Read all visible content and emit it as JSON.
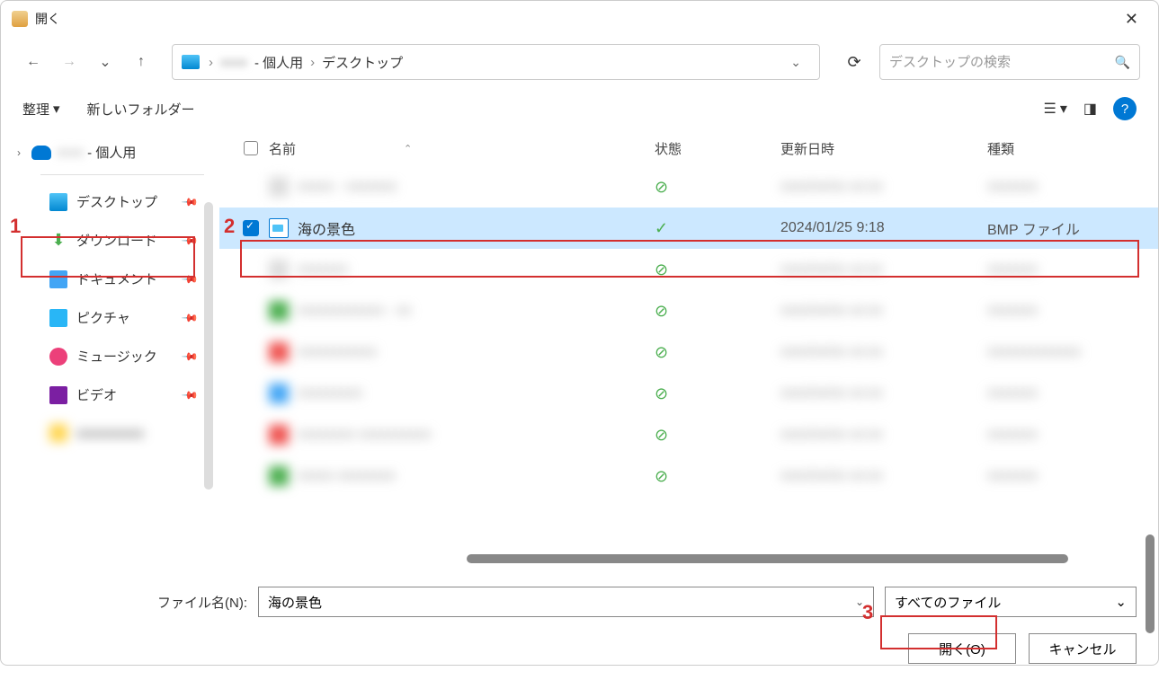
{
  "titlebar": {
    "title": "開く"
  },
  "nav": {
    "path_personal_suffix": "- 個人用",
    "path_desktop": "デスクトップ",
    "search_placeholder": "デスクトップの検索"
  },
  "toolbar": {
    "organize": "整理",
    "new_folder": "新しいフォルダー"
  },
  "sidebar": {
    "personal_suffix": "- 個人用",
    "items": [
      {
        "label": "デスクトップ",
        "icon": "desktop"
      },
      {
        "label": "ダウンロード",
        "icon": "download"
      },
      {
        "label": "ドキュメント",
        "icon": "document"
      },
      {
        "label": "ピクチャ",
        "icon": "pictures"
      },
      {
        "label": "ミュージック",
        "icon": "music"
      },
      {
        "label": "ビデオ",
        "icon": "video"
      }
    ]
  },
  "columns": {
    "name": "名前",
    "state": "状態",
    "modified": "更新日時",
    "type": "種類"
  },
  "selected_file": {
    "name": "海の景色",
    "modified": "2024/01/25 9:18",
    "type": "BMP ファイル"
  },
  "bottom": {
    "filename_label": "ファイル名(N):",
    "filename_value": "海の景色",
    "filter": "すべてのファイル",
    "open": "開く(O)",
    "cancel": "キャンセル"
  },
  "annotations": {
    "a1": "1",
    "a2": "2",
    "a3": "3"
  }
}
